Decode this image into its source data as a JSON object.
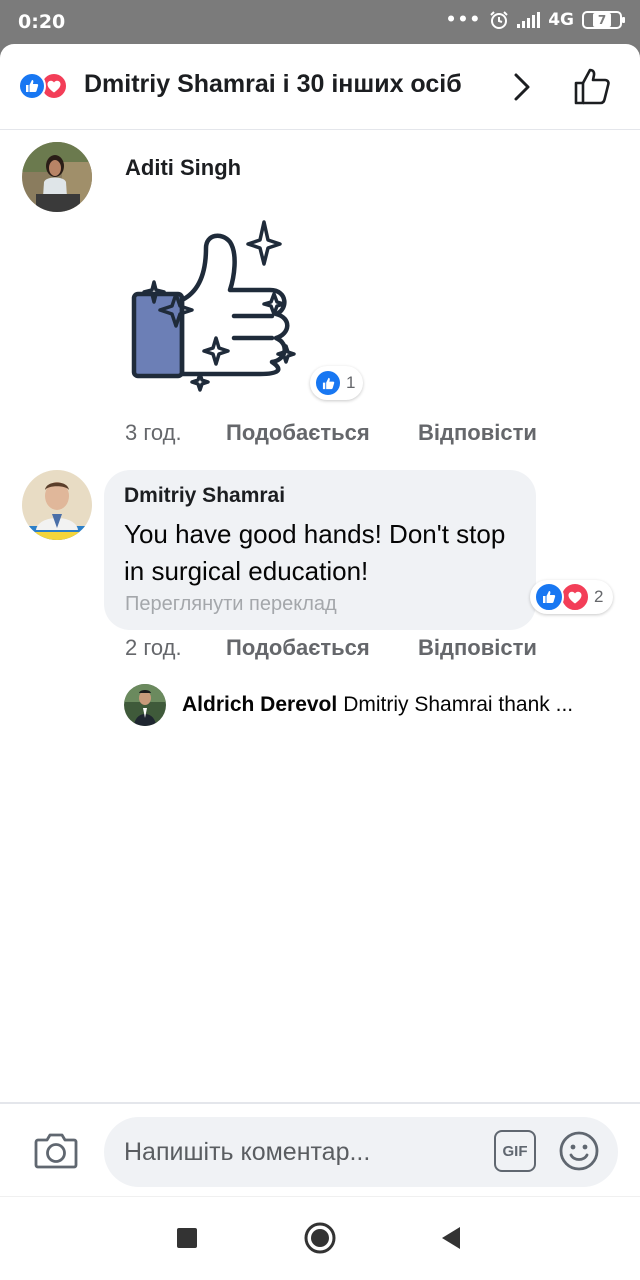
{
  "status_bar": {
    "time": "0:20",
    "dots": "•••",
    "network": "4G",
    "battery": "7"
  },
  "header": {
    "title": "Dmitriy  Shamrai і 30 інших осіб",
    "reaction_icons": [
      "like-icon",
      "love-icon"
    ]
  },
  "comments": [
    {
      "author": "Aditi Singh",
      "content_type": "sticker",
      "sticker": "thumbs-up-sparkles-sticker",
      "reaction_count": "1",
      "time": "3 год.",
      "like_label": "Подобається",
      "reply_label": "Відповісти"
    },
    {
      "author": "Dmitriy  Shamrai",
      "text": "You have good hands! Don't stop in surgical education!",
      "translate_label": "Переглянути переклад",
      "reaction_count": "2",
      "time": "2 год.",
      "like_label": "Подобається",
      "reply_label": "Відповісти",
      "reply": {
        "author": "Aldrich Derevol",
        "text": "Dmitriy  Shamrai thank ..."
      }
    }
  ],
  "composer": {
    "placeholder": "Напишіть коментар...",
    "gif_label": "GIF"
  },
  "colors": {
    "like_blue": "#1877f2",
    "love_red": "#f33e58",
    "bubble_gray": "#f0f2f5",
    "meta_gray": "#65676b"
  }
}
